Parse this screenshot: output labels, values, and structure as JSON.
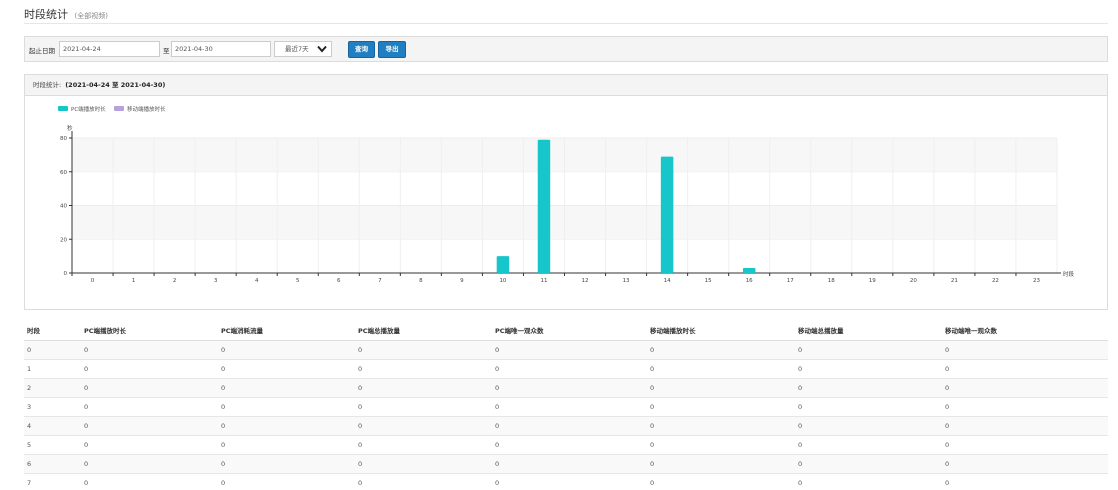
{
  "header": {
    "title": "时段统计",
    "subtitle": "(全部视频)"
  },
  "filter": {
    "start_label": "起止日期",
    "start_value": "2021-04-24",
    "to_label": "至",
    "end_value": "2021-04-30",
    "range_select": "最近7天",
    "query_button": "查询",
    "export_button": "导出"
  },
  "panel": {
    "label": "时段统计:",
    "range": "(2021-04-24 至 2021-04-30)"
  },
  "chart_data": {
    "type": "bar",
    "ylabel": "秒",
    "xlabel": "时段",
    "categories": [
      "0",
      "1",
      "2",
      "3",
      "4",
      "5",
      "6",
      "7",
      "8",
      "9",
      "10",
      "11",
      "12",
      "13",
      "14",
      "15",
      "16",
      "17",
      "18",
      "19",
      "20",
      "21",
      "22",
      "23"
    ],
    "y_ticks": [
      "0",
      "20",
      "40",
      "60",
      "80"
    ],
    "ylim": [
      0,
      80
    ],
    "legend_position": "top-left",
    "grid": true,
    "series": [
      {
        "name": "PC端播放时长",
        "color": "#16c6cb",
        "values": [
          0,
          0,
          0,
          0,
          0,
          0,
          0,
          0,
          0,
          0,
          10,
          79,
          0,
          0,
          69,
          0,
          3,
          0,
          0,
          0,
          0,
          0,
          0,
          0
        ]
      },
      {
        "name": "移动端播放时长",
        "color": "#b5a1dc",
        "values": [
          0,
          0,
          0,
          0,
          0,
          0,
          0,
          0,
          0,
          0,
          0,
          0,
          0,
          0,
          0,
          0,
          0,
          0,
          0,
          0,
          0,
          0,
          0,
          0
        ]
      }
    ]
  },
  "table": {
    "headers": [
      "时段",
      "PC端播放时长",
      "PC端消耗流量",
      "PC端总播放量",
      "PC端唯一观众数",
      "移动端播放时长",
      "移动端总播放量",
      "移动端唯一观众数"
    ],
    "rows": [
      [
        "0",
        "0",
        "0",
        "0",
        "0",
        "0",
        "0",
        "0"
      ],
      [
        "1",
        "0",
        "0",
        "0",
        "0",
        "0",
        "0",
        "0"
      ],
      [
        "2",
        "0",
        "0",
        "0",
        "0",
        "0",
        "0",
        "0"
      ],
      [
        "3",
        "0",
        "0",
        "0",
        "0",
        "0",
        "0",
        "0"
      ],
      [
        "4",
        "0",
        "0",
        "0",
        "0",
        "0",
        "0",
        "0"
      ],
      [
        "5",
        "0",
        "0",
        "0",
        "0",
        "0",
        "0",
        "0"
      ],
      [
        "6",
        "0",
        "0",
        "0",
        "0",
        "0",
        "0",
        "0"
      ],
      [
        "7",
        "0",
        "0",
        "0",
        "0",
        "0",
        "0",
        "0"
      ]
    ]
  },
  "colors": {
    "accent": "#1f7fc0",
    "bar_pc": "#16c6cb",
    "bar_mobile": "#b5a1dc"
  },
  "icons": {
    "dropdown": "chevron-down-icon"
  }
}
